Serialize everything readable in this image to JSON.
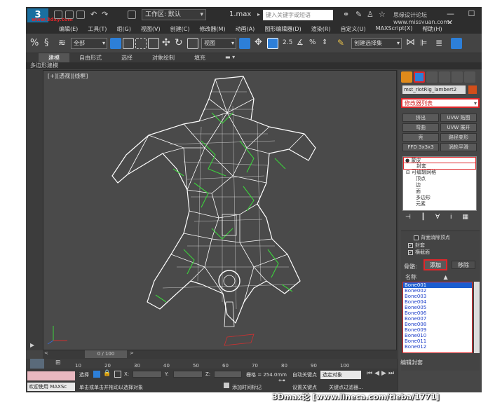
{
  "titlebar": {
    "workspace": "工作区: 默认",
    "file_title": "1.max",
    "search_placeholder": "键入关键字或短语",
    "forum": "思缘设计论坛 www.missyuan.com",
    "window_buttons": "— ☐ ✕"
  },
  "menu": [
    "编辑(E)",
    "工具(T)",
    "组(G)",
    "视图(V)",
    "创建(C)",
    "修改器(M)",
    "动画(A)",
    "图形编辑器(D)",
    "渲染(R)",
    "自定义(U)",
    "MAXScript(X)",
    "帮助(H)"
  ],
  "toolbar": {
    "filter_value": "全部",
    "ref_coord": "视图",
    "selection_set": "创建选择集"
  },
  "ribbon": {
    "tabs": [
      "建模",
      "自由形式",
      "选择",
      "对象绘制",
      "填充"
    ],
    "sub": "多边形建模"
  },
  "viewport": {
    "label": "[+][透视][线框]"
  },
  "cmdpanel": {
    "object_name": "mst_riotRig_lambert2",
    "modifier_list": "修改器列表",
    "modifier_buttons": [
      "挤出",
      "UVW 贴图",
      "弯曲",
      "UVW 展开",
      "壳",
      "路径变形",
      "FFD 3x3x3",
      "涡轮平滑"
    ],
    "stack": [
      "蒙皮",
      "封套",
      "可编辑网格",
      "顶点",
      "边",
      "面",
      "多边形",
      "元素"
    ],
    "stack_tools": "⊣ ┃ ∀ ⅰ ▦",
    "options": {
      "backface": "背面消除顶点",
      "envelopes": "封套",
      "cross_sections": "横截面"
    },
    "bones_label": "骨骼:",
    "add_label": "添加",
    "remove_label": "移除",
    "name_header": "名称",
    "name_sort": "▲",
    "bones": [
      "Bone001",
      "Bone002",
      "Bone003",
      "Bone004",
      "Bone005",
      "Bone006",
      "Bone007",
      "Bone008",
      "Bone009",
      "Bone010",
      "Bone011",
      "Bone012"
    ],
    "edit_envelope": "编辑封套"
  },
  "timeline": {
    "frame_counter": "0 / 100",
    "ticks": [
      "10",
      "20",
      "30",
      "40",
      "50",
      "60",
      "70",
      "80",
      "90",
      "100"
    ]
  },
  "status": {
    "select_label": "选择",
    "x_label": "X:",
    "y_label": "Y:",
    "z_label": "Z:",
    "grid": "栅格 = 254.0mm",
    "auto_key": "自动关键点",
    "selected_obj": "选定对象",
    "set_key": "设置关键点",
    "key_filters": "关键点过滤器...",
    "welcome": "欢迎使用 MAXSc",
    "hint": "单击或单击并拖动以选择对象",
    "add_time_tag": "添加时间标记"
  },
  "watermark": "3Dmax论 [www.lineca.com/tieba/1771]",
  "site_logo": "www.3dxy.com",
  "colors": {
    "accent_red": "#e0262a",
    "wire_white": "#ffffff",
    "wire_green": "#3cd23c",
    "bone_selected": "#1a5dd0"
  }
}
